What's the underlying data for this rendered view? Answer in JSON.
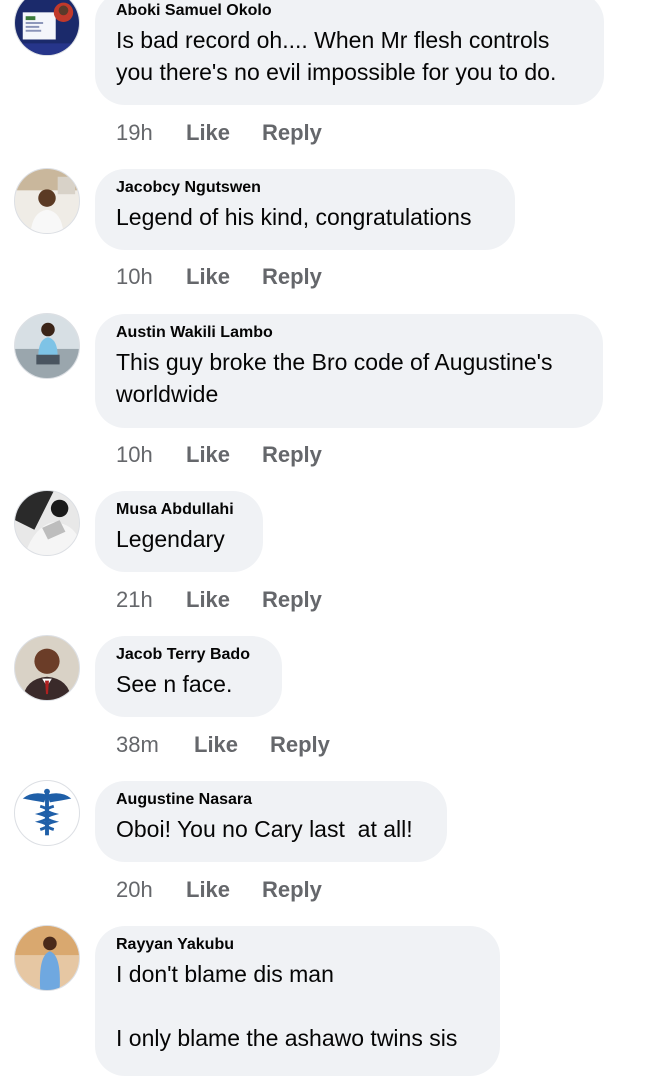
{
  "actions": {
    "like_label": "Like",
    "reply_label": "Reply"
  },
  "comments": [
    {
      "author": "Aboki Samuel Okolo",
      "text": "Is bad record oh.... When Mr flesh controls you there's no evil impossible for you to do.",
      "time": "19h",
      "avatar_icon": "poster-avatar-icon"
    },
    {
      "author": "Jacobcy Ngutswen",
      "text": "Legend of his kind, congratulations",
      "time": "10h",
      "avatar_icon": "person-avatar-icon"
    },
    {
      "author": "Austin Wakili Lambo",
      "text": "This guy broke the Bro code of Augustine's worldwide",
      "time": "10h",
      "avatar_icon": "person-avatar-icon"
    },
    {
      "author": "Musa Abdullahi",
      "text": "Legendary",
      "time": "21h",
      "avatar_icon": "bw-photo-avatar-icon"
    },
    {
      "author": "Jacob Terry Bado",
      "text": "See n face.",
      "time": "38m",
      "avatar_icon": "person-suit-avatar-icon"
    },
    {
      "author": "Augustine Nasara",
      "text": "Oboi! You no Cary last  at all!",
      "time": "20h",
      "avatar_icon": "caduceus-avatar-icon"
    },
    {
      "author": "Rayyan Yakubu",
      "text": "I don't blame dis man\n\nI only blame the ashawo twins sis",
      "time": "",
      "avatar_icon": "person-avatar-icon"
    }
  ]
}
